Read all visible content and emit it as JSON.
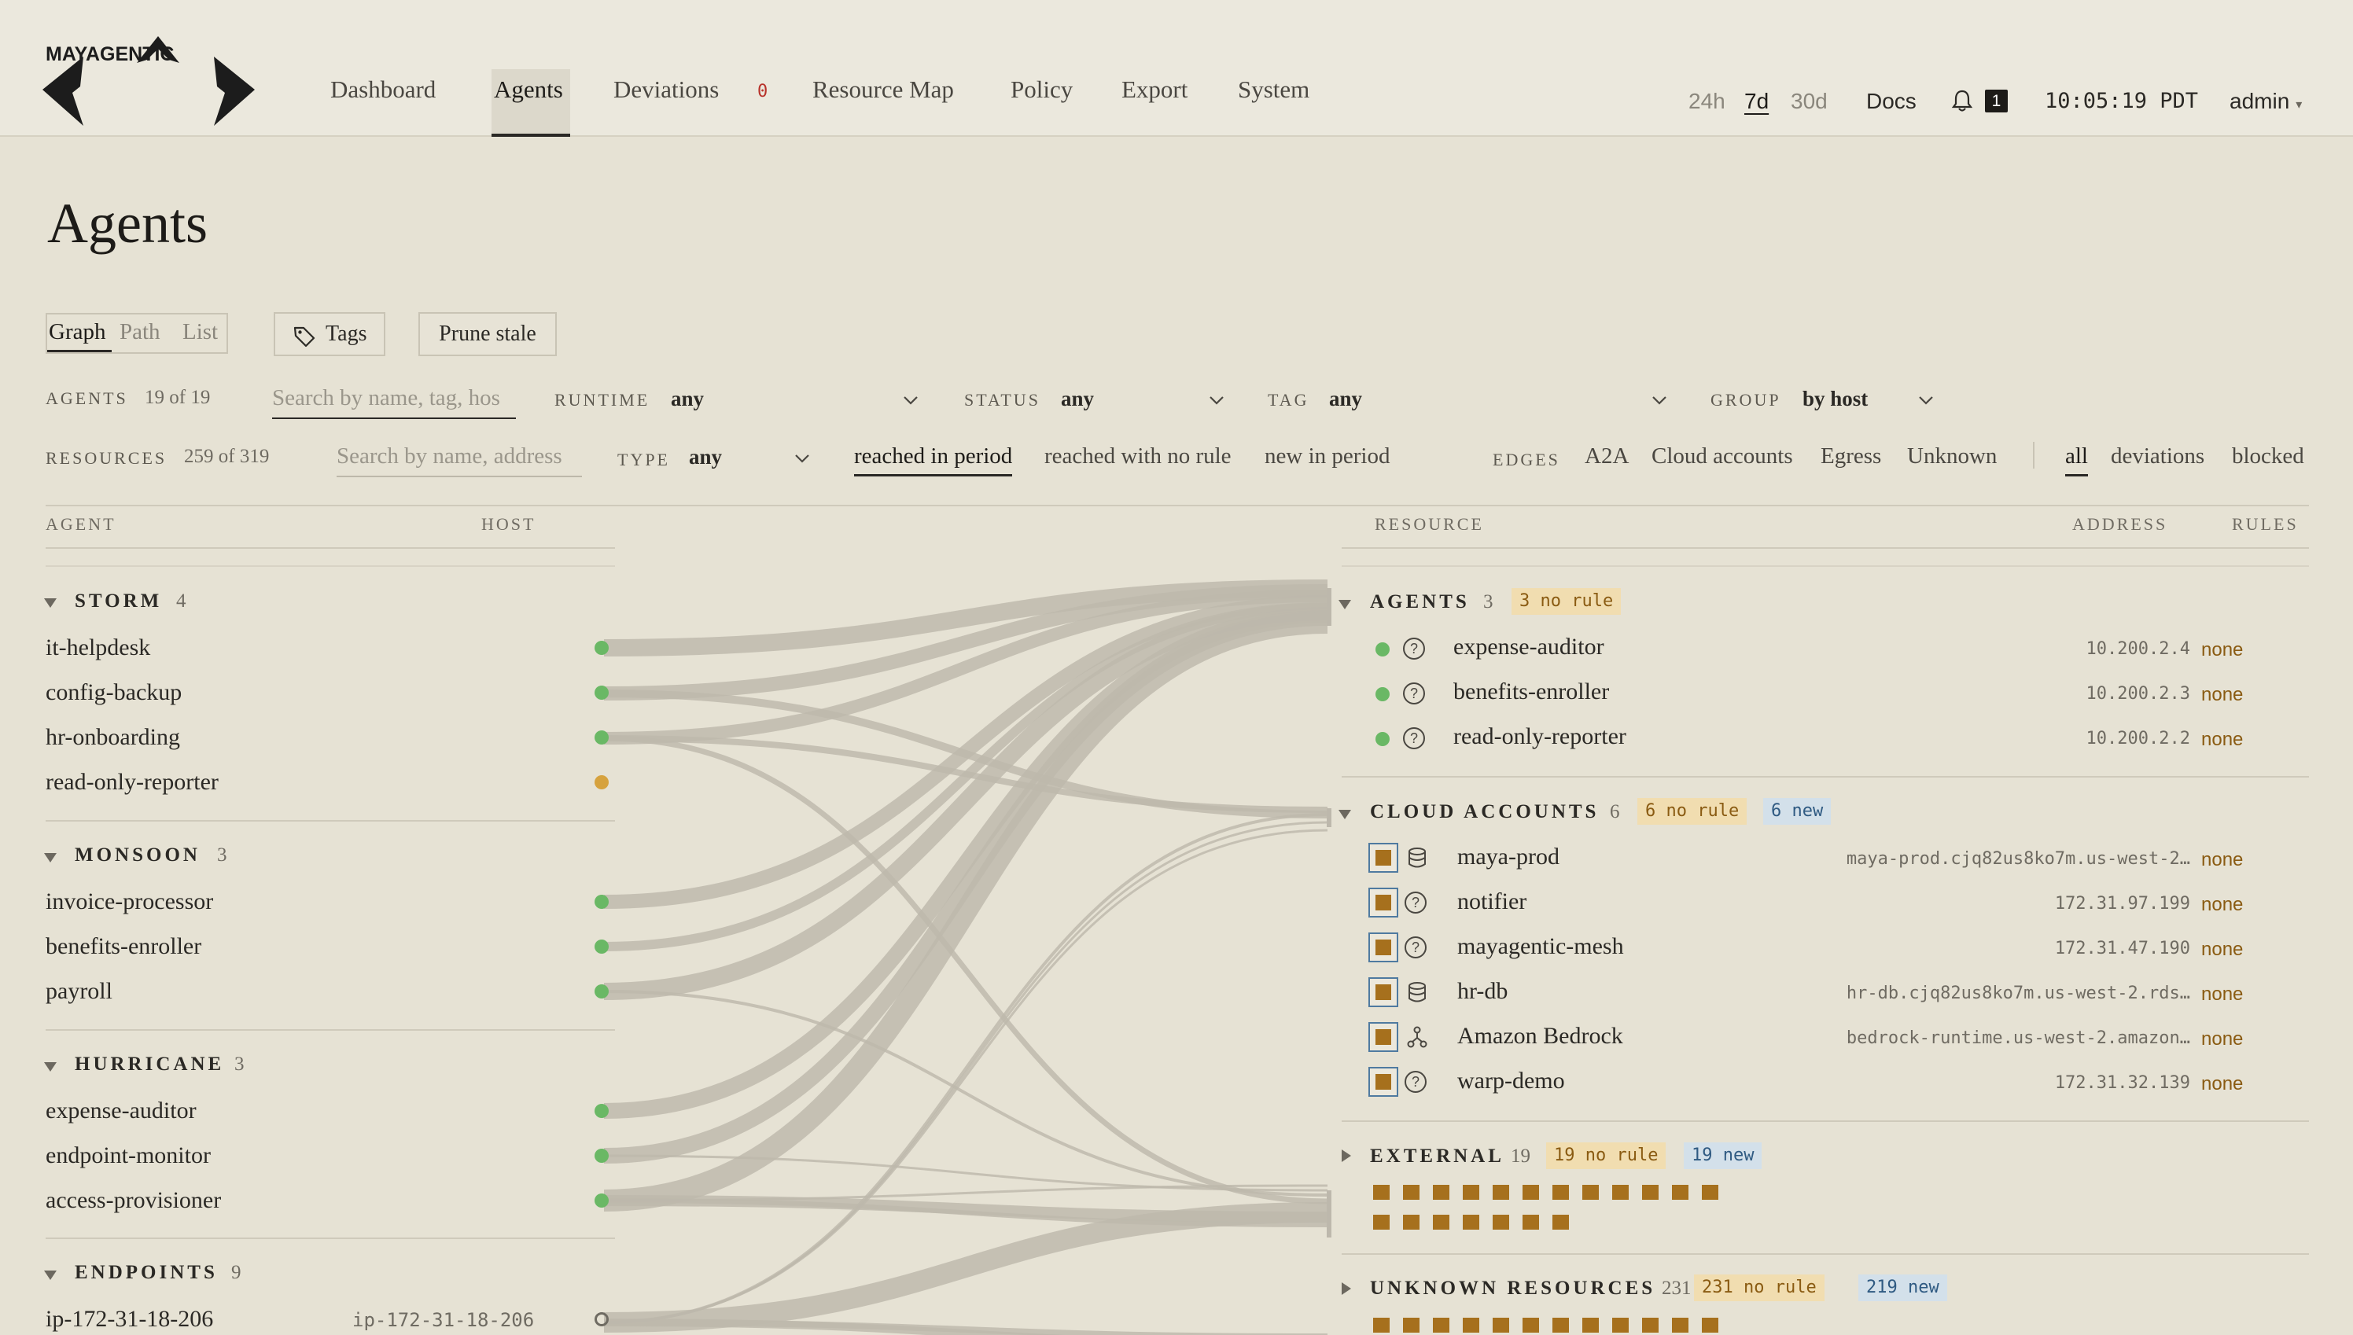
{
  "brand": {
    "name": "MAYAGENTIC"
  },
  "nav": {
    "items": [
      "Dashboard",
      "Agents",
      "Deviations",
      "Resource Map",
      "Policy",
      "Export",
      "System"
    ],
    "active": "Agents",
    "deviations_count": "0"
  },
  "header": {
    "ranges": [
      "24h",
      "7d",
      "30d"
    ],
    "active_range": "7d",
    "docs": "Docs",
    "notifications": "1",
    "clock": "10:05:19 PDT",
    "user": "admin"
  },
  "page": {
    "title": "Agents",
    "views": [
      "Graph",
      "Path",
      "List"
    ],
    "active_view": "Graph",
    "tags_button": "Tags",
    "prune_button": "Prune stale"
  },
  "agent_filters": {
    "label": "AGENTS",
    "count": "19 of 19",
    "search_placeholder": "Search by name, tag, hos",
    "runtime_label": "RUNTIME",
    "runtime_value": "any",
    "status_label": "STATUS",
    "status_value": "any",
    "tag_label": "TAG",
    "tag_value": "any",
    "group_label": "GROUP",
    "group_value": "by host"
  },
  "resource_filters": {
    "label": "RESOURCES",
    "count": "259 of 319",
    "search_placeholder": "Search by name, address",
    "type_label": "TYPE",
    "type_value": "any",
    "period_options": [
      "reached in period",
      "reached with no rule",
      "new in period"
    ],
    "active_period": "reached in period",
    "edges_label": "EDGES",
    "edge_types": [
      "A2A",
      "Cloud accounts",
      "Egress",
      "Unknown"
    ],
    "scope_options": [
      "all",
      "deviations",
      "blocked"
    ],
    "active_scope": "all"
  },
  "agent_columns": {
    "agent": "AGENT",
    "host": "HOST"
  },
  "resource_columns": {
    "resource": "RESOURCE",
    "address": "ADDRESS",
    "rules": "RULES"
  },
  "agent_groups": [
    {
      "name": "STORM",
      "count": "4",
      "agents": [
        {
          "name": "it-helpdesk",
          "status": "green"
        },
        {
          "name": "config-backup",
          "status": "green"
        },
        {
          "name": "hr-onboarding",
          "status": "green"
        },
        {
          "name": "read-only-reporter",
          "status": "amber"
        }
      ]
    },
    {
      "name": "MONSOON",
      "count": "3",
      "agents": [
        {
          "name": "invoice-processor",
          "status": "green"
        },
        {
          "name": "benefits-enroller",
          "status": "green"
        },
        {
          "name": "payroll",
          "status": "green"
        }
      ]
    },
    {
      "name": "HURRICANE",
      "count": "3",
      "agents": [
        {
          "name": "expense-auditor",
          "status": "green"
        },
        {
          "name": "endpoint-monitor",
          "status": "green"
        },
        {
          "name": "access-provisioner",
          "status": "green"
        }
      ]
    },
    {
      "name": "ENDPOINTS",
      "count": "9",
      "agents": [
        {
          "name": "ip-172-31-18-206",
          "host": "ip-172-31-18-206",
          "status": "hollow"
        }
      ]
    }
  ],
  "resource_groups": {
    "agents": {
      "name": "AGENTS",
      "count": "3",
      "no_rule": "3 no rule",
      "items": [
        {
          "name": "expense-auditor",
          "address": "10.200.2.4",
          "rule": "none",
          "icon": "question-icon"
        },
        {
          "name": "benefits-enroller",
          "address": "10.200.2.3",
          "rule": "none",
          "icon": "question-icon"
        },
        {
          "name": "read-only-reporter",
          "address": "10.200.2.2",
          "rule": "none",
          "icon": "question-icon"
        }
      ]
    },
    "cloud": {
      "name": "CLOUD ACCOUNTS",
      "count": "6",
      "no_rule": "6 no rule",
      "new": "6 new",
      "items": [
        {
          "name": "maya-prod",
          "address": "maya-prod.cjq82us8ko7m.us-west-2…",
          "rule": "none",
          "icon": "database-icon"
        },
        {
          "name": "notifier",
          "address": "172.31.97.199",
          "rule": "none",
          "icon": "question-icon"
        },
        {
          "name": "mayagentic-mesh",
          "address": "172.31.47.190",
          "rule": "none",
          "icon": "question-icon"
        },
        {
          "name": "hr-db",
          "address": "hr-db.cjq82us8ko7m.us-west-2.rds…",
          "rule": "none",
          "icon": "database-icon"
        },
        {
          "name": "Amazon Bedrock",
          "address": "bedrock-runtime.us-west-2.amazon…",
          "rule": "none",
          "icon": "model-icon"
        },
        {
          "name": "warp-demo",
          "address": "172.31.32.139",
          "rule": "none",
          "icon": "question-icon"
        }
      ]
    },
    "external": {
      "name": "EXTERNAL",
      "count": "19",
      "no_rule": "19 no rule",
      "new": "19 new",
      "tiles": 19
    },
    "unknown": {
      "name": "UNKNOWN RESOURCES",
      "count": "231",
      "no_rule": "231 no rule",
      "new": "219 new"
    }
  },
  "colors": {
    "background": "#e6e2d4",
    "status_green": "#6ab865",
    "status_amber": "#d6a23e",
    "no_rule_tag": "#f1ddb0",
    "new_tag": "#d3e0ea",
    "resource_tile": "#a6701d",
    "flow": "#bdb8ac"
  }
}
